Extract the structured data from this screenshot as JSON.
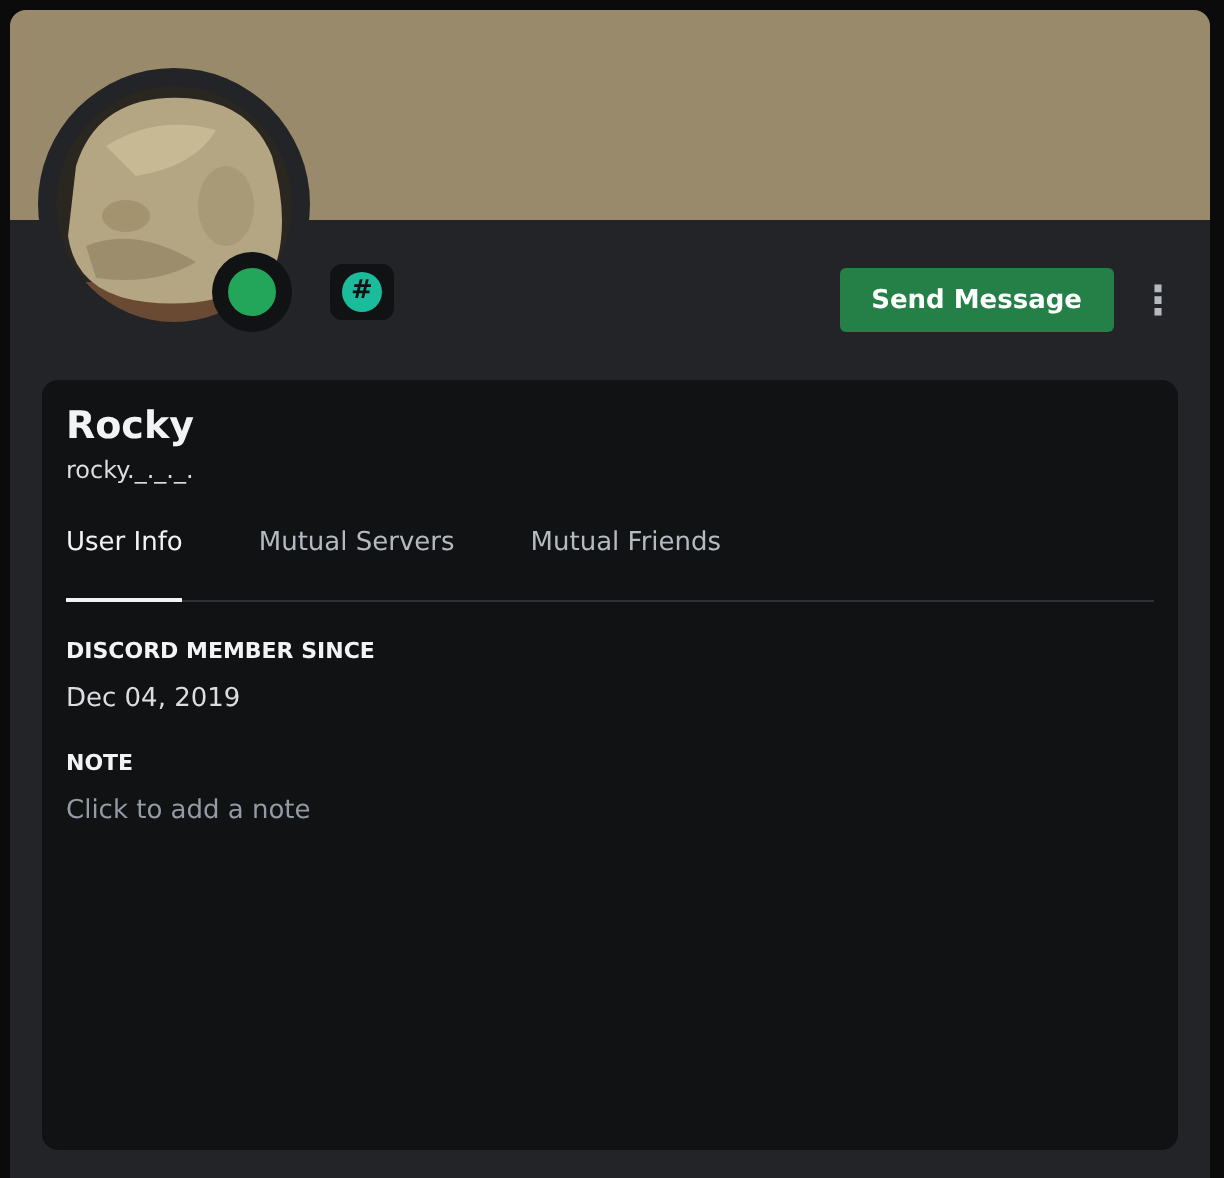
{
  "profile": {
    "display_name": "Rocky",
    "username": "rocky._._._.",
    "online": true,
    "badge": "#"
  },
  "actions": {
    "primary_button": "Send Message",
    "more_button": "⋮"
  },
  "tabs": [
    {
      "label": "User Info",
      "selected": true
    },
    {
      "label": "Mutual Servers",
      "selected": false
    },
    {
      "label": "Mutual Friends",
      "selected": false
    }
  ],
  "sections": [
    {
      "heading": "DISCORD MEMBER SINCE",
      "text": "Dec 04, 2019",
      "kind": "value"
    },
    {
      "heading": "NOTE",
      "text": "Click to add a note",
      "kind": "placeholder"
    }
  ]
}
